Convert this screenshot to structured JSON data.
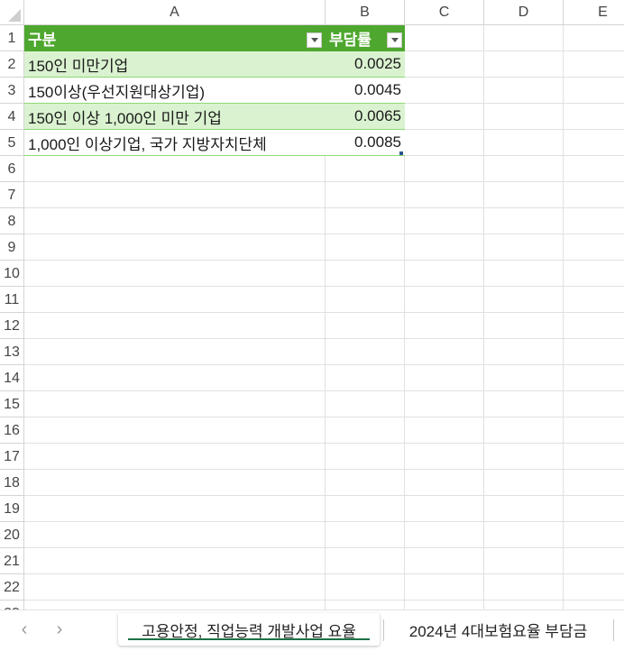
{
  "columns": [
    "A",
    "B",
    "C",
    "D",
    "E"
  ],
  "rows": [
    "1",
    "2",
    "3",
    "4",
    "5",
    "6",
    "7",
    "8",
    "9",
    "10",
    "11",
    "12",
    "13",
    "14",
    "15",
    "16",
    "17",
    "18",
    "19",
    "20",
    "21",
    "22",
    "23"
  ],
  "table": {
    "headers": [
      "구분",
      "부담률"
    ],
    "rows": [
      {
        "label": "150인 미만기업",
        "value": "0.0025"
      },
      {
        "label": "150이상(우선지원대상기업)",
        "value": "0.0045"
      },
      {
        "label": "150인 이상 1,000인 미만 기업",
        "value": "0.0065"
      },
      {
        "label": "1,000인 이상기업, 국가 지방자치단체",
        "value": "0.0085"
      }
    ]
  },
  "sheet_tabs": [
    {
      "label": "고용안정, 직업능력 개발사업 요율",
      "active": true
    },
    {
      "label": "2024년 4대보험요율 부담금",
      "active": false
    }
  ],
  "colors": {
    "table_header": "#4ea72e",
    "band": "#daf2d0",
    "table_border": "#8ed973",
    "active_tab_underline": "#1e7145"
  }
}
